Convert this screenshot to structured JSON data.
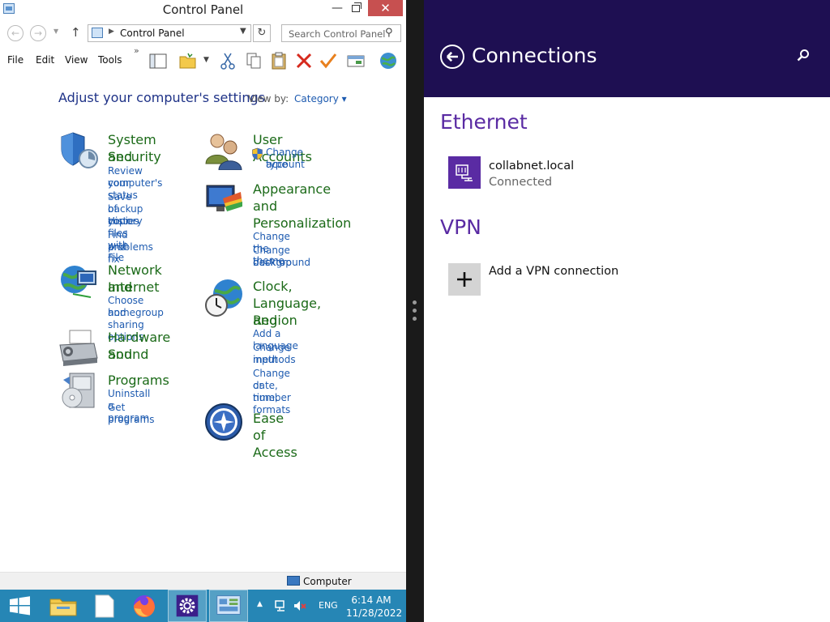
{
  "control_panel": {
    "window_title": "Control Panel",
    "address": "Control Panel",
    "search_placeholder": "Search Control Panel",
    "menu": [
      "File",
      "Edit",
      "View",
      "Tools"
    ],
    "heading": "Adjust your computer's settings",
    "view_by_label": "View by:",
    "view_by_value": "Category ▾",
    "categories": [
      {
        "title_lines": [
          "System and",
          "Security"
        ],
        "icon": "shield-icon",
        "links": [
          "Review your",
          "computer's status",
          "Save backup copies",
          "of your files with File",
          "History",
          "Find and fix",
          "problems"
        ]
      },
      {
        "title_lines": [
          "Network and",
          "Internet"
        ],
        "icon": "network-globe-icon",
        "links": [
          "Choose homegroup",
          "and sharing options"
        ]
      },
      {
        "title_lines": [
          "Hardware and",
          "Sound"
        ],
        "icon": "printer-icon",
        "links": []
      },
      {
        "title_lines": [
          "Programs"
        ],
        "icon": "programs-icon",
        "links": [
          "Uninstall a program",
          "Get programs"
        ]
      },
      {
        "title_lines": [
          "User Accounts"
        ],
        "icon": "users-icon",
        "links": [
          "Change account",
          "type"
        ]
      },
      {
        "title_lines": [
          "Appearance",
          "and",
          "Personalization"
        ],
        "icon": "appearance-icon",
        "links": [
          "Change the theme",
          "Change desktop",
          "background"
        ]
      },
      {
        "title_lines": [
          "Clock,",
          "Language, and",
          "Region"
        ],
        "icon": "clock-globe-icon",
        "links": [
          "Add a language",
          "Change input",
          "methods",
          "Change date, time,",
          "or number formats"
        ]
      },
      {
        "title_lines": [
          "Ease of Access"
        ],
        "icon": "ease-of-access-icon",
        "links": []
      }
    ],
    "status_text": "Computer"
  },
  "taskbar": {
    "lang": "ENG",
    "time": "6:14 AM",
    "date": "11/28/2022"
  },
  "charm": {
    "title": "Connections",
    "ethernet_header": "Ethernet",
    "ethernet_name": "collabnet.local",
    "ethernet_status": "Connected",
    "vpn_header": "VPN",
    "vpn_add": "Add a VPN connection",
    "colors": {
      "header": "#1e0f52",
      "accent": "#5a2ba3",
      "tile": "#5a2ba3"
    }
  }
}
